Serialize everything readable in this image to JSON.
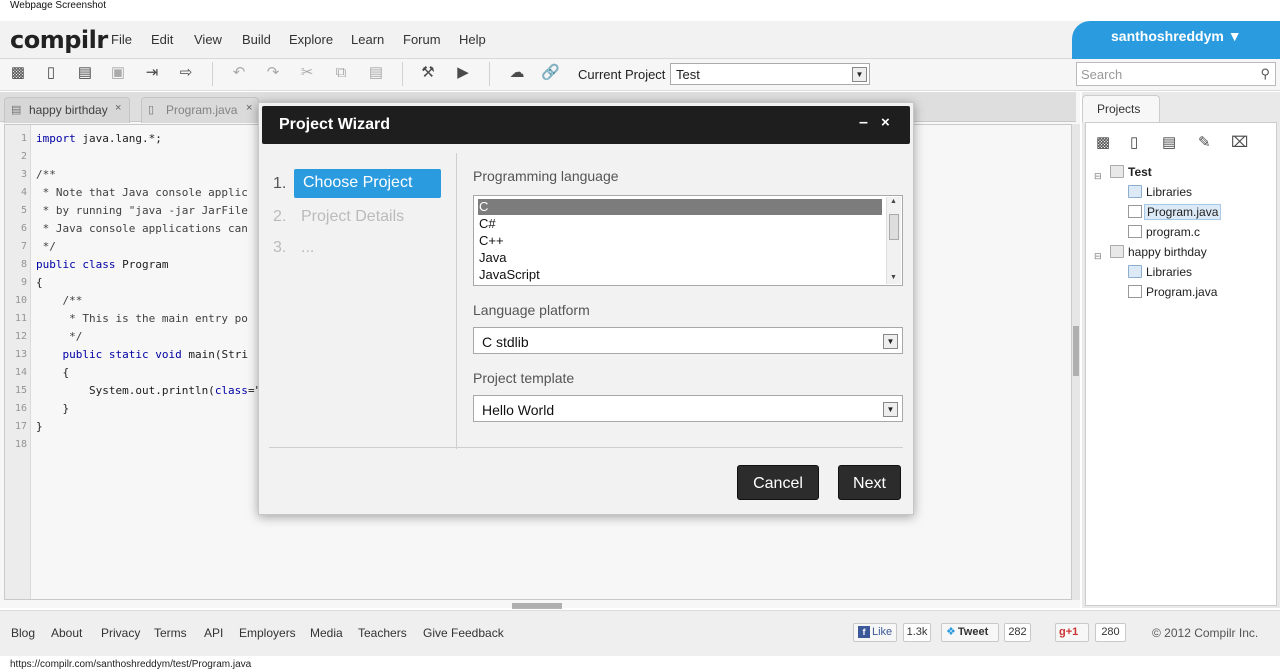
{
  "browser": {
    "caption": "Webpage Screenshot",
    "status_url": "https://compilr.com/santhoshreddym/test/Program.java"
  },
  "app": {
    "logo": "compilr",
    "menu": [
      "File",
      "Edit",
      "View",
      "Build",
      "Explore",
      "Learn",
      "Forum",
      "Help"
    ],
    "user": "santhoshreddym ▼"
  },
  "toolbar": {
    "icons": [
      "new-file-icon",
      "new-document-icon",
      "open-folder-icon",
      "save-icon",
      "import-icon",
      "export-icon",
      "undo-icon",
      "redo-icon",
      "cut-icon",
      "copy-icon",
      "paste-icon",
      "build-icon",
      "run-icon",
      "cloud-download-icon",
      "link-icon"
    ],
    "current_project_label": "Current Project",
    "current_project_value": "Test",
    "search_placeholder": "Search"
  },
  "editor": {
    "tabs": [
      {
        "label": "happy birthday"
      },
      {
        "label": "Program.java"
      }
    ],
    "line_numbers": [
      "1",
      "2",
      "3",
      "4",
      "5",
      "6",
      "7",
      "8",
      "9",
      "10",
      "11",
      "12",
      "13",
      "14",
      "15",
      "16",
      "17",
      "18"
    ],
    "lines": [
      "import java.lang.*;",
      "",
      "/**",
      " * Note that Java console applic",
      " * by running \"java -jar JarFile",
      " * Java console applications can",
      " */",
      "public class Program",
      "{",
      "    /**",
      "     * This is the main entry po",
      "     */",
      "    public static void main(Stri",
      "    {",
      "        System.out.println(\"MAKE",
      "    }",
      "}",
      ""
    ]
  },
  "projects": {
    "tab_label": "Projects",
    "panel_icons": [
      "new-file-icon",
      "new-document-icon",
      "new-folder-icon",
      "properties-icon",
      "delete-icon"
    ],
    "tree": [
      {
        "name": "Test",
        "type": "project"
      },
      {
        "name": "Libraries",
        "type": "folder"
      },
      {
        "name": "Program.java",
        "type": "java"
      },
      {
        "name": "program.c",
        "type": "c"
      },
      {
        "name": "happy birthday",
        "type": "project"
      },
      {
        "name": "Libraries",
        "type": "folder"
      },
      {
        "name": "Program.java",
        "type": "java"
      }
    ]
  },
  "dialog": {
    "title": "Project Wizard",
    "minimize": "–",
    "close": "×",
    "steps": [
      {
        "num": "1.",
        "label": "Choose Project"
      },
      {
        "num": "2.",
        "label": "Project Details"
      },
      {
        "num": "3.",
        "label": "..."
      }
    ],
    "language_label": "Programming language",
    "languages": [
      "C",
      "C#",
      "C++",
      "Java",
      "JavaScript"
    ],
    "selected_language": "C",
    "platform_label": "Language platform",
    "platform_value": "C stdlib",
    "template_label": "Project template",
    "template_value": "Hello World",
    "cancel": "Cancel",
    "next": "Next"
  },
  "footer": {
    "links": [
      "Blog",
      "About",
      "Privacy",
      "Terms",
      "API",
      "Employers",
      "Media",
      "Teachers",
      "Give Feedback"
    ],
    "like_label": "Like",
    "like_count": "1.3k",
    "tweet_label": "Tweet",
    "tweet_count": "282",
    "plusone_label": "+1",
    "plusone_count": "280",
    "copyright": "© 2012 Compilr Inc."
  },
  "colors": {
    "accent": "#2b9be0",
    "dialog_title_bg": "#1e1e1e",
    "button_bg": "#2c2c2c"
  }
}
